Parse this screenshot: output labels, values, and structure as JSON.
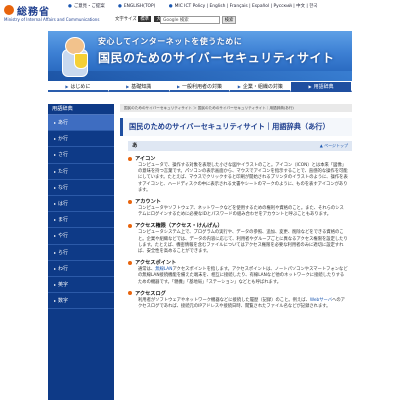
{
  "header": {
    "logo_name": "総務省",
    "logo_sub": "Ministry of Internal Affairs and Communications",
    "top_links": [
      "ご意見・ご提案",
      "ENGLISH(TOP)",
      "MIC ICT Policy | English | Français | Español | Русский | 中文 | 한국"
    ],
    "font_size_label": "文字サイズ",
    "font_size_buttons": [
      "標準",
      "大"
    ],
    "search_placeholder": "Google 検索",
    "search_button": "検索"
  },
  "banner": {
    "tagline": "安心してインターネットを使うために",
    "title": "国民のためのサイバーセキュリティサイト"
  },
  "nav": [
    {
      "label": "はじめに",
      "active": false
    },
    {
      "label": "基礎知識",
      "active": false
    },
    {
      "label": "一般利用者の対策",
      "active": false
    },
    {
      "label": "企業・組織の対策",
      "active": false
    },
    {
      "label": "用語辞典",
      "active": true
    }
  ],
  "sidebar": {
    "heading": "用語辞典",
    "items": [
      {
        "label": "あ行",
        "current": true
      },
      {
        "label": "か行",
        "current": false
      },
      {
        "label": "さ行",
        "current": false
      },
      {
        "label": "た行",
        "current": false
      },
      {
        "label": "な行",
        "current": false
      },
      {
        "label": "は行",
        "current": false
      },
      {
        "label": "ま行",
        "current": false
      },
      {
        "label": "や行",
        "current": false
      },
      {
        "label": "ら行",
        "current": false
      },
      {
        "label": "わ行",
        "current": false
      },
      {
        "label": "英字",
        "current": false
      },
      {
        "label": "数字",
        "current": false
      }
    ]
  },
  "breadcrumb": "国民のためのサイバーセキュリティサイト ＞ 国民のためのサイバーセキュリティサイト｜用語辞典(あ行)",
  "page_title": "国民のためのサイバーセキュリティサイト｜用語辞典（あ行）",
  "section": {
    "heading": "あ",
    "to_top": "ページトップ"
  },
  "entries": [
    {
      "term": "アイコン",
      "desc": "コンピュータで、操作する対象を表現した小さな図やイラストのこと。アイコン（ICON）とは本来「図像」の意味を持つ言葉です。パソコンの表示画面から、マウスでアイコンを指示することで、直感的な操作を可能にしています。たとえば、マウスでクリックすると印刷が開始されるプリンタのイラストのように、操作を表すアイコンと、ハードディスクの中に表示される文書やシートのマークのように、ものを表すアイコンがあります。"
    },
    {
      "term": "アカウント",
      "desc": "コンピュータやソフトウェア、ネットワークなどを使用するための権利や資格のこと。また、それらのシステムにログインするために必要なIDとパスワードの組み合わせをアカウントと呼ぶこともあります。"
    },
    {
      "term": "アクセス権限（アクセス・けんげん）",
      "desc": "コンピュータシステム上で、プログラムの実行や、データの参照、追加、変更、削除などをできる資格のこと。企業や組織などでは、データの内容に応じて、利用者やグループごとに異なるアクセス権限を設定したりします。たとえば、機密情報を含むファイルについてはアクセス権限を必要な利用者のみに適切に設定すれば、安全性を高めることができます。"
    },
    {
      "term": "アクセスポイント",
      "desc_pre": "通常は、",
      "desc_link": "無線LAN",
      "desc_post": "アクセスポイントを指します。アクセスポイントは、ノートパソコンやスマートフォンなどの無線LAN接続機能を備えた端末を、相互に接続したり、有線LANなど他のネットワークに接続したりするための機器です。「親機」「基地局」「ステーション」などとも呼ばれます。"
    },
    {
      "term": "アクセスログ",
      "desc_pre": "利用者がソフトウェアやネットワーク機器などに接続した履歴（記録）のこと。例えば、",
      "desc_link": "Webサーバ",
      "desc_post": "へのアクセスログであれば、接続元のIPアドレスや接続日時、閲覧されたファイル名などが記録されます。"
    }
  ]
}
